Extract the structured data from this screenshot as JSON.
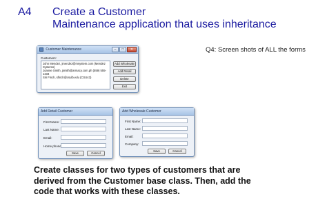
{
  "slide": {
    "code": "A4",
    "title_line1": "Create a Customer",
    "title_line2": "Maintenance application that uses inheritance",
    "note": "Q4: Screen shots of ALL the forms",
    "description_line1": "Create classes for two types of customers that are",
    "description_line2": "derived from the Customer base class. Then, add the",
    "description_line3": "code that works with these classes."
  },
  "colors": {
    "title": "#1a1aa0",
    "window_bg": "#edf1f7",
    "titlebar": "#a8c4e6"
  },
  "maintenance_window": {
    "title": "Customer Maintenance",
    "minimize_icon": "minimize-icon",
    "maximize_icon": "maximize-icon",
    "close_icon": "close-icon",
    "customers_label": "Customers:",
    "customers": [
      "John Mendez, jmendez@msystem.com (Mendez Systems)",
      "Joanne Smith, jsmith@armacy.com.ph  (559) 555-1234",
      "Siri Finch, sfinch@csulb.edu (CSU43)"
    ],
    "buttons": {
      "add_wholesale": "Add Wholesale",
      "add_retail": "Add Retail",
      "delete": "Delete",
      "exit": "Exit"
    }
  },
  "retail_window": {
    "title": "Add Retail Customer",
    "labels": {
      "first_name": "First Name:",
      "last_name": "Last Name:",
      "email": "Email:",
      "home_phone": "Home phone:"
    },
    "buttons": {
      "save": "Save",
      "cancel": "Cancel"
    }
  },
  "wholesale_window": {
    "title": "Add Wholesale Customer",
    "labels": {
      "first_name": "First Name:",
      "last_name": "Last Name:",
      "email": "Email:",
      "company": "Company:"
    },
    "buttons": {
      "save": "Save",
      "cancel": "Cancel"
    }
  }
}
